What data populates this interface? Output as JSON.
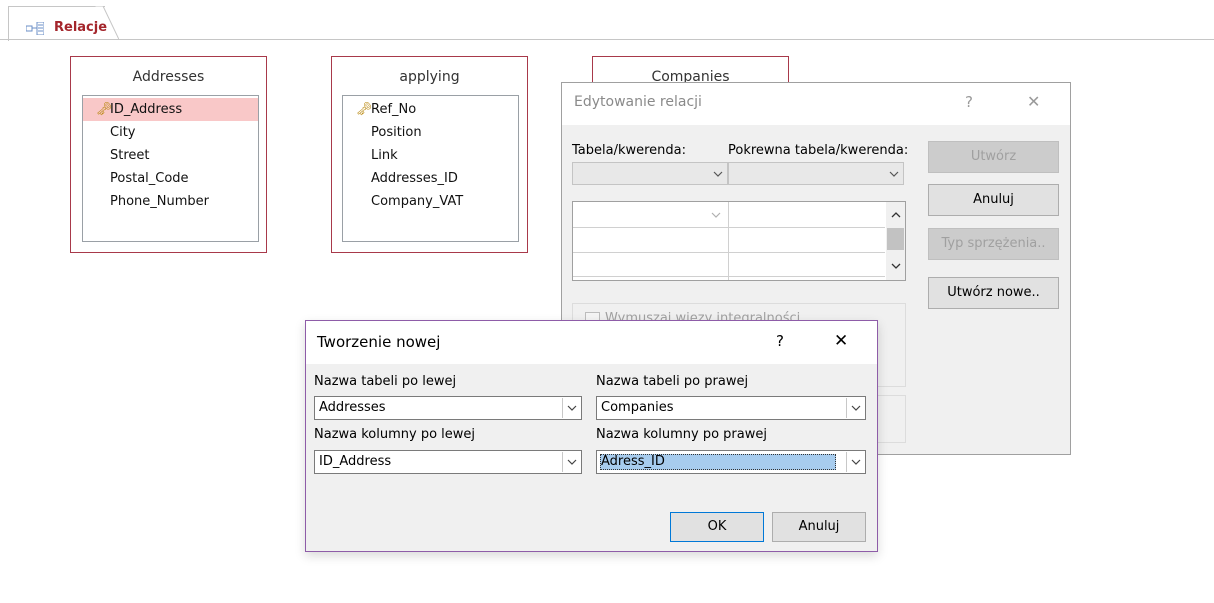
{
  "tab": {
    "label": "Relacje",
    "icon": "relationships-icon"
  },
  "tables": [
    {
      "title": "Addresses",
      "fields": [
        "ID_Address",
        "City",
        "Street",
        "Postal_Code",
        "Phone_Number"
      ],
      "key_field": "ID_Address"
    },
    {
      "title": "applying",
      "fields": [
        "Ref_No",
        "Position",
        "Link",
        "Addresses_ID",
        "Company_VAT"
      ],
      "key_field": "Ref_No"
    },
    {
      "title": "Companies"
    }
  ],
  "edit_dialog": {
    "title": "Edytowanie relacji",
    "help": "?",
    "close": "✕",
    "table_label": "Tabela/kwerenda:",
    "related_label": "Pokrewna tabela/kwerenda:",
    "create_label": "Utwórz",
    "cancel_label": "Anuluj",
    "join_label": "Typ sprzężenia..",
    "create_new_label": "Utwórz nowe..",
    "integrity_label": "Wymuszaj więzy integralności"
  },
  "new_dialog": {
    "title": "Tworzenie nowej",
    "help": "?",
    "close": "✕",
    "left_table_label": "Nazwa tabeli po lewej",
    "right_table_label": "Nazwa tabeli po prawej",
    "left_column_label": "Nazwa kolumny po lewej",
    "right_column_label": "Nazwa kolumny po prawej",
    "left_table_value": "Addresses",
    "right_table_value": "Companies",
    "left_column_value": "ID_Address",
    "right_column_value": "Adress_ID",
    "ok_label": "OK",
    "cancel_label": "Anuluj"
  }
}
